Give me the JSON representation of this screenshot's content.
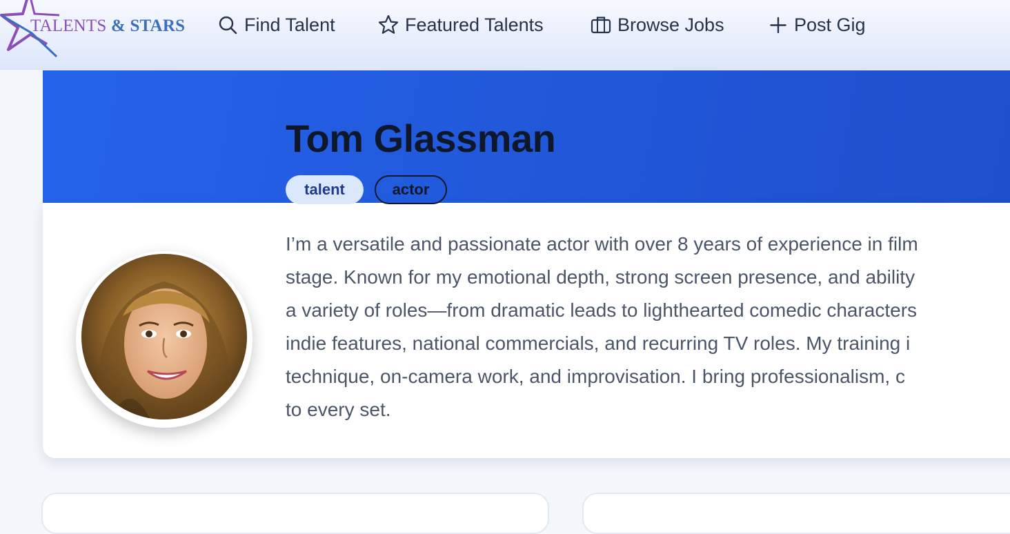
{
  "brand": {
    "logo_word1": "TALENTS",
    "logo_amp": "&",
    "logo_word2": "STARS"
  },
  "nav": {
    "items": [
      {
        "label": "Find Talent",
        "icon": "search-icon"
      },
      {
        "label": "Featured Talents",
        "icon": "star-icon"
      },
      {
        "label": "Browse Jobs",
        "icon": "briefcase-icon"
      },
      {
        "label": "Post Gig",
        "icon": "plus-icon"
      }
    ]
  },
  "profile": {
    "name": "Tom Glassman",
    "tags": [
      "talent",
      "actor"
    ],
    "bio_lines": [
      "I’m a versatile and passionate actor with over 8 years of experience in film",
      "stage. Known for my emotional depth, strong screen presence, and ability",
      "a variety of roles—from dramatic leads to lighthearted comedic characters",
      "indie features, national commercials, and recurring TV roles. My training i",
      "technique, on-camera work, and improvisation. I bring professionalism, c",
      "to every set."
    ]
  },
  "colors": {
    "hero_blue": "#2563eb",
    "name_dark": "#0f172a",
    "logo_purple": "#8a4fb8",
    "logo_blue": "#3a6fc0",
    "tag_fill": "#dbe7fb"
  }
}
